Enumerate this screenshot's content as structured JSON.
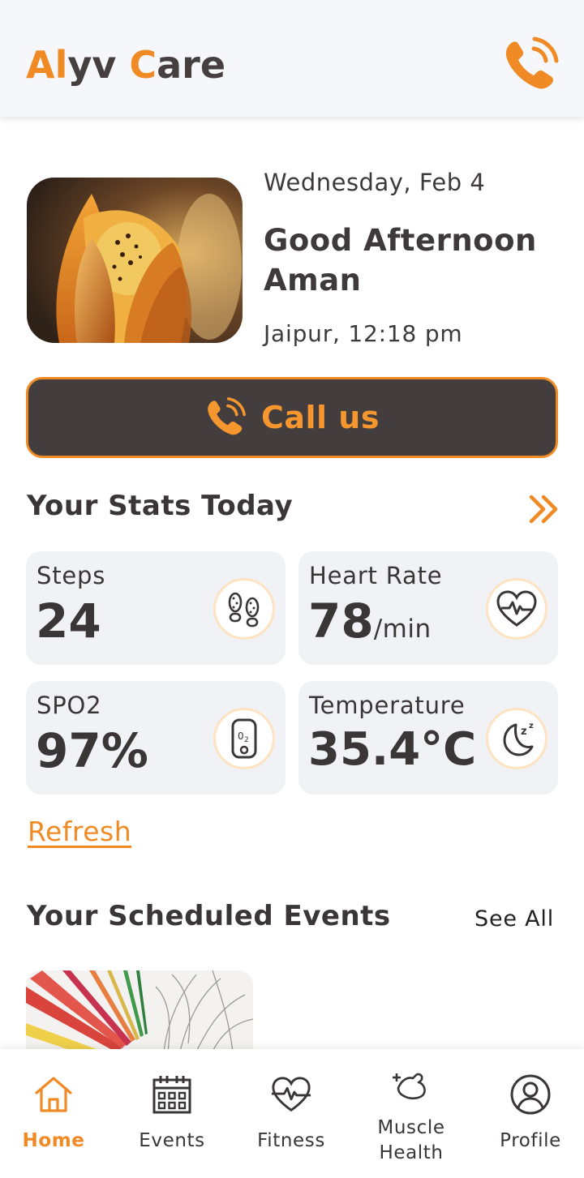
{
  "header": {
    "logo_part1": "Al",
    "logo_part2": "yv ",
    "logo_part3": "C",
    "logo_part4": "are",
    "accent_color": "#f08a24"
  },
  "greeting": {
    "date": "Wednesday, Feb 4",
    "salutation": "Good Afternoon",
    "name": "Aman",
    "location_time": "Jaipur, 12:18 pm"
  },
  "call_button": {
    "label": "Call us"
  },
  "stats": {
    "title": "Your Stats Today",
    "cards": [
      {
        "label": "Steps",
        "value": "24",
        "unit": "",
        "icon": "footsteps-icon"
      },
      {
        "label": "Heart Rate",
        "value": "78",
        "unit": "/min",
        "icon": "heart-pulse-icon"
      },
      {
        "label": "SPO2",
        "value": "97%",
        "unit": "",
        "icon": "oximeter-icon"
      },
      {
        "label": "Temperature",
        "value": "35.4°C",
        "unit": "",
        "icon": "moon-sleep-icon"
      }
    ],
    "refresh_label": "Refresh"
  },
  "events": {
    "title": "Your Scheduled Events",
    "see_all": "See All"
  },
  "nav": {
    "items": [
      {
        "label": "Home",
        "active": true,
        "icon": "home-icon"
      },
      {
        "label": "Events",
        "active": false,
        "icon": "calendar-icon"
      },
      {
        "label": "Fitness",
        "active": false,
        "icon": "heart-pulse-icon"
      },
      {
        "label": "Muscle Health",
        "active": false,
        "icon": "muscle-icon"
      },
      {
        "label": "Profile",
        "active": false,
        "icon": "user-icon"
      }
    ]
  }
}
